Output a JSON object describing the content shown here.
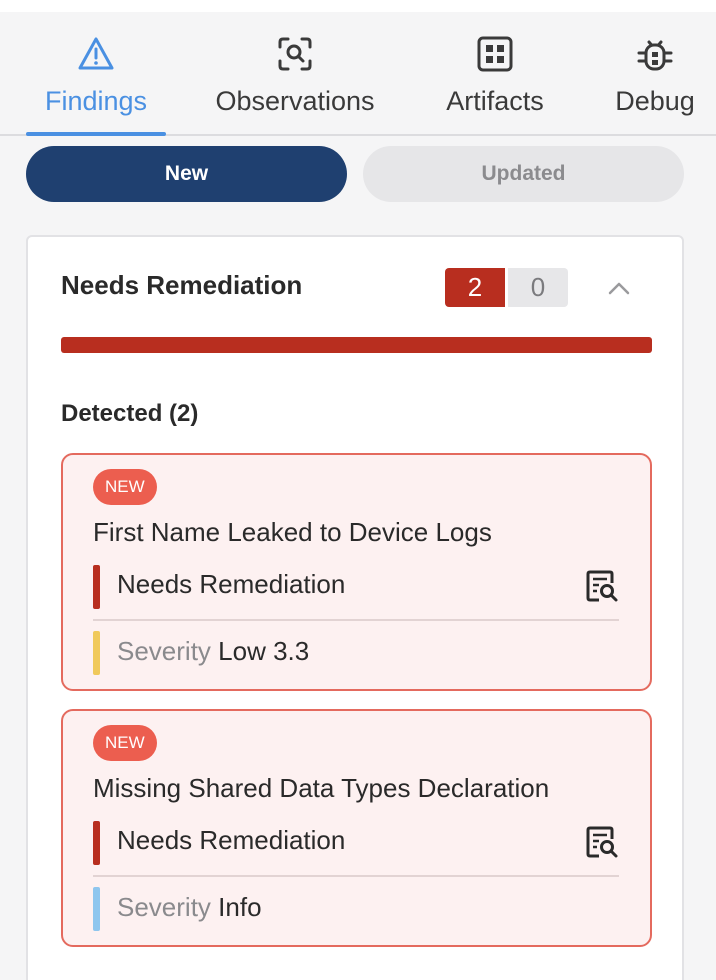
{
  "tabs": [
    {
      "label": "Findings",
      "icon": "warning-triangle-icon",
      "active": true
    },
    {
      "label": "Observations",
      "icon": "search-frame-icon",
      "active": false
    },
    {
      "label": "Artifacts",
      "icon": "grid-icon",
      "active": false
    },
    {
      "label": "Debug",
      "icon": "bug-icon",
      "active": false
    }
  ],
  "segments": {
    "new_label": "New",
    "updated_label": "Updated",
    "selected": "New"
  },
  "section": {
    "title": "Needs Remediation",
    "count_primary": "2",
    "count_secondary": "0",
    "detected_label": "Detected (2)",
    "progress_fraction": 1.0,
    "progress_color": "#b82e1f"
  },
  "findings": [
    {
      "badge": "NEW",
      "title": "First Name Leaked to Device Logs",
      "status": "Needs Remediation",
      "severity_label": "Severity",
      "severity_value": "Low 3.3",
      "severity_color": "#f0c95b"
    },
    {
      "badge": "NEW",
      "title": "Missing Shared Data Types Declaration",
      "status": "Needs Remediation",
      "severity_label": "Severity",
      "severity_value": "Info",
      "severity_color": "#8ec6ee"
    }
  ],
  "colors": {
    "accent": "#4a90e2",
    "primary_button": "#1f4070",
    "danger": "#b82e1f",
    "badge": "#ec5e4f"
  }
}
